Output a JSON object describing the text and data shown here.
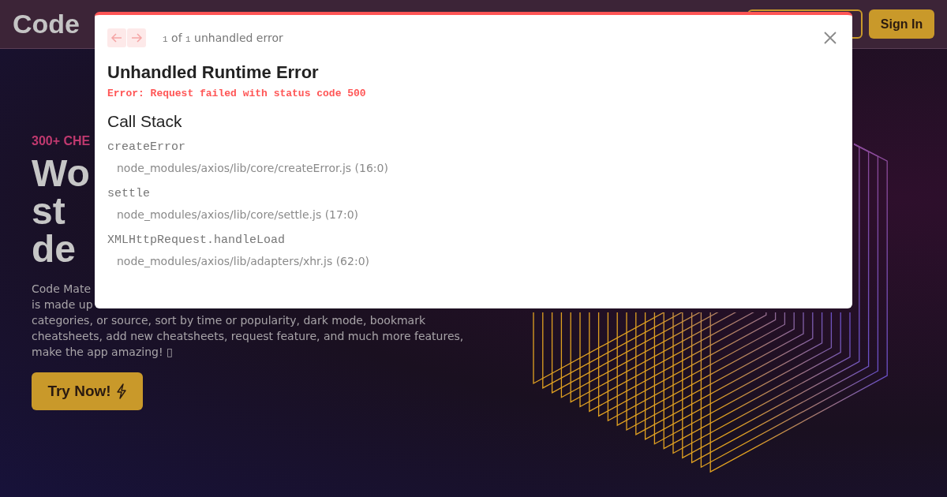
{
  "navbar": {
    "logo": "Code",
    "buttons": [
      {
        "kind": "outline"
      },
      {
        "kind": "filled",
        "label": "Sign In"
      }
    ]
  },
  "hero": {
    "eyebrow": "300+ CHE",
    "heading_lines": [
      "Wo",
      "st",
      "de"
    ],
    "description_lines": [
      "Code Mate",
      "is made up",
      "categories, or source, sort by time or popularity, dark mode, bookmark",
      "cheatsheets, add new cheatsheets, request feature, and much more features,",
      "make the app amazing! ▯"
    ],
    "cta": "Try Now!"
  },
  "error_overlay": {
    "counter": {
      "current": "1",
      "connector": "of",
      "total": "1",
      "label": "unhandled error"
    },
    "nav_buttons": [
      {
        "kind": "prev",
        "disabled": true
      },
      {
        "kind": "next",
        "disabled": true
      }
    ],
    "title": "Unhandled Runtime Error",
    "message": "Error: Request failed with status code 500",
    "call_stack_title": "Call Stack",
    "frames": [
      {
        "function": "createError",
        "location": "node_modules/axios/lib/core/createError.js (16:0)"
      },
      {
        "function": "settle",
        "location": "node_modules/axios/lib/core/settle.js (17:0)"
      },
      {
        "function": "XMLHttpRequest.handleLoad",
        "location": "node_modules/axios/lib/adapters/xhr.js (62:0)"
      }
    ]
  }
}
